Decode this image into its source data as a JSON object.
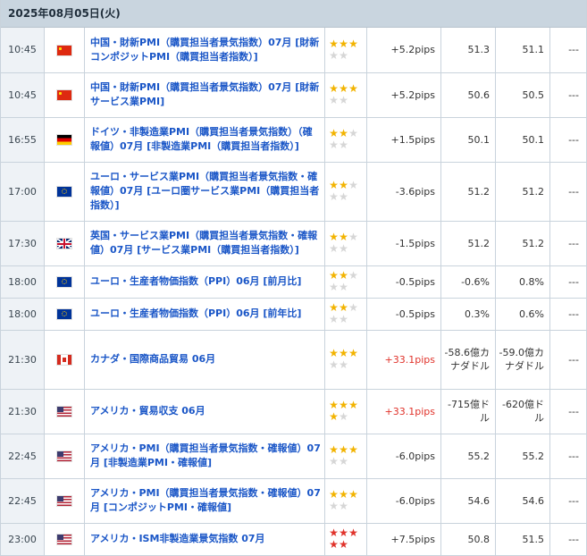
{
  "date": "2025年08月05日(火)",
  "colors": {
    "header_bg": "#c9d5df",
    "link": "#1a56c7",
    "star_on": "#f2b300",
    "star_off": "#d6d6d6",
    "star_red": "#e0332b",
    "hot": "#e0332b"
  },
  "rows": [
    {
      "time": "10:45",
      "flag": "china-flag-icon",
      "name": "中国・財新PMI（購買担当者景気指数）07月 [財新コンポジットPMI（購買担当者指数）]",
      "stars": [
        "on",
        "on",
        "on",
        "off",
        "off"
      ],
      "pips": "+5.2pips",
      "hot": false,
      "actual": "51.3",
      "prev": "51.1",
      "result": "---",
      "h": 50
    },
    {
      "time": "10:45",
      "flag": "china-flag-icon",
      "name": "中国・財新PMI（購買担当者景気指数）07月 [財新サービス業PMI]",
      "stars": [
        "on",
        "on",
        "on",
        "off",
        "off"
      ],
      "pips": "+5.2pips",
      "hot": false,
      "actual": "50.6",
      "prev": "50.5",
      "result": "---",
      "h": 50
    },
    {
      "time": "16:55",
      "flag": "germany-flag-icon",
      "name": "ドイツ・非製造業PMI（購買担当者景気指数）（確報値）07月 [非製造業PMI（購買担当者指数）]",
      "stars": [
        "on",
        "on",
        "off",
        "off",
        "off"
      ],
      "pips": "+1.5pips",
      "hot": false,
      "actual": "50.1",
      "prev": "50.1",
      "result": "---",
      "h": 50
    },
    {
      "time": "17:00",
      "flag": "eu-flag-icon",
      "name": "ユーロ・サービス業PMI（購買担当者景気指数・確報値）07月 [ユーロ圏サービス業PMI（購買担当者指数）]",
      "stars": [
        "on",
        "on",
        "off",
        "off",
        "off"
      ],
      "pips": "-3.6pips",
      "hot": false,
      "actual": "51.2",
      "prev": "51.2",
      "result": "---",
      "h": 66
    },
    {
      "time": "17:30",
      "flag": "uk-flag-icon",
      "name": "英国・サービス業PMI（購買担当者景気指数・確報値）07月 [サービス業PMI（購買担当者指数）]",
      "stars": [
        "on",
        "on",
        "off",
        "off",
        "off"
      ],
      "pips": "-1.5pips",
      "hot": false,
      "actual": "51.2",
      "prev": "51.2",
      "result": "---",
      "h": 50
    },
    {
      "time": "18:00",
      "flag": "eu-flag-icon",
      "name": "ユーロ・生産者物価指数（PPI）06月 [前月比]",
      "stars": [
        "on",
        "on",
        "off",
        "off",
        "off"
      ],
      "pips": "-0.5pips",
      "hot": false,
      "actual": "-0.6%",
      "prev": "0.8%",
      "result": "---",
      "h": 36
    },
    {
      "time": "18:00",
      "flag": "eu-flag-icon",
      "name": "ユーロ・生産者物価指数（PPI）06月 [前年比]",
      "stars": [
        "on",
        "on",
        "off",
        "off",
        "off"
      ],
      "pips": "-0.5pips",
      "hot": false,
      "actual": "0.3%",
      "prev": "0.6%",
      "result": "---",
      "h": 36
    },
    {
      "time": "21:30",
      "flag": "canada-flag-icon",
      "name": "カナダ・国際商品貿易 06月",
      "stars": [
        "on",
        "on",
        "on",
        "off",
        "off"
      ],
      "pips": "+33.1pips",
      "hot": true,
      "actual": "-58.6億カナダドル",
      "prev": "-59.0億カナダドル",
      "result": "---",
      "h": 66
    },
    {
      "time": "21:30",
      "flag": "usa-flag-icon",
      "name": "アメリカ・貿易収支 06月",
      "stars": [
        "on",
        "on",
        "on",
        "on",
        "off"
      ],
      "pips": "+33.1pips",
      "hot": true,
      "actual": "-715億ドル",
      "prev": "-620億ドル",
      "result": "---",
      "h": 50
    },
    {
      "time": "22:45",
      "flag": "usa-flag-icon",
      "name": "アメリカ・PMI（購買担当者景気指数・確報値）07月 [非製造業PMI・確報値]",
      "stars": [
        "on",
        "on",
        "on",
        "off",
        "off"
      ],
      "pips": "-6.0pips",
      "hot": false,
      "actual": "55.2",
      "prev": "55.2",
      "result": "---",
      "h": 50
    },
    {
      "time": "22:45",
      "flag": "usa-flag-icon",
      "name": "アメリカ・PMI（購買担当者景気指数・確報値）07月 [コンポジットPMI・確報値]",
      "stars": [
        "on",
        "on",
        "on",
        "off",
        "off"
      ],
      "pips": "-6.0pips",
      "hot": false,
      "actual": "54.6",
      "prev": "54.6",
      "result": "---",
      "h": 50
    },
    {
      "time": "23:00",
      "flag": "usa-flag-icon",
      "name": "アメリカ・ISM非製造業景気指数 07月",
      "stars": [
        "red",
        "red",
        "red",
        "red",
        "red"
      ],
      "pips": "+7.5pips",
      "hot": false,
      "actual": "50.8",
      "prev": "51.5",
      "result": "---",
      "h": 36
    }
  ]
}
